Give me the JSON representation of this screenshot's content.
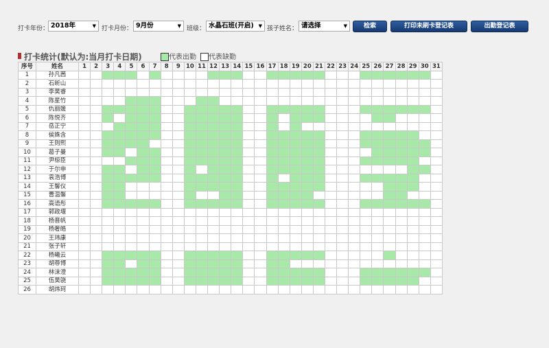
{
  "filters": {
    "year_label": "打卡年份：",
    "year_value": "2018年",
    "month_label": "打卡月份：",
    "month_value": "9月份",
    "class_label": "班级：",
    "class_value": "水晶石班(开启)",
    "child_label": "孩子姓名：",
    "child_value": "请选择",
    "search_button": "检索",
    "print_unswiped_button": "打印未刷卡登记表",
    "attendance_register_button": "出勤登记表"
  },
  "section_title": "打卡统计(默认为:当月打卡日期)",
  "legend": {
    "present_label": "代表出勤",
    "absent_label": "代表缺勤",
    "present_color": "#a8e8a8",
    "absent_color": "#ffffff"
  },
  "table": {
    "col_index": "序号",
    "col_name": "姓名",
    "days": [
      "1",
      "2",
      "3",
      "4",
      "5",
      "6",
      "7",
      "8",
      "9",
      "10",
      "11",
      "12",
      "13",
      "14",
      "15",
      "16",
      "17",
      "18",
      "19",
      "20",
      "21",
      "22",
      "23",
      "24",
      "25",
      "26",
      "27",
      "28",
      "29",
      "30",
      "31"
    ],
    "rows": [
      {
        "no": "1",
        "name": "孙凡茜",
        "present": [
          3,
          4,
          5,
          7,
          12,
          13,
          14,
          17,
          18,
          19,
          20,
          21,
          25,
          26,
          27,
          28,
          29,
          30
        ]
      },
      {
        "no": "2",
        "name": "石昕山",
        "present": []
      },
      {
        "no": "3",
        "name": "李昊睿",
        "present": []
      },
      {
        "no": "4",
        "name": "陈星竹",
        "present": [
          5,
          6,
          7,
          11,
          12
        ]
      },
      {
        "no": "5",
        "name": "仇丽媛",
        "present": [
          3,
          4,
          5,
          6,
          7,
          10,
          11,
          12,
          13,
          14,
          17,
          18,
          19,
          20,
          21,
          25,
          26,
          27,
          28,
          29,
          30
        ]
      },
      {
        "no": "6",
        "name": "陈悦齐",
        "present": [
          3,
          5,
          6,
          7,
          10,
          11,
          12,
          13,
          14,
          17,
          19,
          20,
          21,
          26,
          27
        ]
      },
      {
        "no": "7",
        "name": "岳正宁",
        "present": [
          4,
          5,
          6,
          7,
          10,
          11,
          12,
          13,
          14,
          17,
          19
        ]
      },
      {
        "no": "8",
        "name": "侯姝含",
        "present": [
          3,
          4,
          5,
          6,
          7,
          10,
          11,
          12,
          13,
          14,
          17,
          18,
          19,
          20,
          21,
          25,
          26,
          27,
          28,
          29
        ]
      },
      {
        "no": "9",
        "name": "王则熙",
        "present": [
          3,
          4,
          5,
          6,
          10,
          11,
          12,
          13,
          14,
          17,
          18,
          19,
          20,
          21,
          25,
          26,
          27,
          28,
          29,
          30
        ]
      },
      {
        "no": "10",
        "name": "葛子曼",
        "present": [
          3,
          4,
          6,
          7,
          10,
          11,
          12,
          13,
          14,
          17,
          18,
          19,
          20,
          21,
          26,
          27,
          28,
          29,
          30
        ]
      },
      {
        "no": "11",
        "name": "尹椋臣",
        "present": [
          5,
          6,
          7,
          10,
          11,
          12,
          13,
          14,
          17,
          18,
          19,
          20,
          21,
          25,
          26,
          27,
          28,
          29
        ]
      },
      {
        "no": "12",
        "name": "于尔申",
        "present": [
          3,
          4,
          6,
          7,
          10,
          12,
          13,
          14,
          17,
          18,
          19,
          20,
          21,
          29,
          30
        ]
      },
      {
        "no": "13",
        "name": "袁浩博",
        "present": [
          3,
          4,
          5,
          6,
          7,
          10,
          11,
          12,
          13,
          14,
          17,
          19,
          20,
          21,
          25,
          26,
          27,
          28,
          29
        ]
      },
      {
        "no": "14",
        "name": "王馨仪",
        "present": [
          3,
          4,
          10,
          11,
          12,
          13,
          14,
          17,
          18,
          19,
          20,
          21,
          27,
          28,
          29
        ]
      },
      {
        "no": "15",
        "name": "曹温馨",
        "present": [
          3,
          4,
          10,
          13,
          14,
          17,
          18,
          19,
          20,
          27,
          28
        ]
      },
      {
        "no": "16",
        "name": "高语彤",
        "present": [
          3,
          4,
          5,
          6,
          7,
          10,
          11,
          12,
          13,
          14,
          17,
          18,
          19,
          20,
          21,
          25,
          26,
          27,
          28,
          29,
          30
        ]
      },
      {
        "no": "17",
        "name": "郭政堰",
        "present": []
      },
      {
        "no": "18",
        "name": "杨晋帆",
        "present": []
      },
      {
        "no": "19",
        "name": "杨奢皓",
        "present": []
      },
      {
        "no": "20",
        "name": "王玮康",
        "present": []
      },
      {
        "no": "21",
        "name": "张子轩",
        "present": []
      },
      {
        "no": "22",
        "name": "杨曦云",
        "present": [
          3,
          4,
          5,
          6,
          7,
          10,
          11,
          12,
          13,
          14,
          17,
          18,
          19,
          20,
          21,
          27
        ]
      },
      {
        "no": "23",
        "name": "胡尊博",
        "present": [
          3,
          4,
          6,
          7,
          10,
          11,
          12,
          13,
          14,
          17,
          18
        ]
      },
      {
        "no": "24",
        "name": "林沫澄",
        "present": [
          3,
          4,
          5,
          6,
          7,
          10,
          11,
          12,
          13,
          14,
          17,
          18,
          19,
          20,
          21,
          25,
          26,
          27,
          28,
          29,
          30
        ]
      },
      {
        "no": "25",
        "name": "伍昊骁",
        "present": [
          3,
          4,
          5,
          6,
          7,
          10,
          11,
          12,
          13,
          14,
          17,
          18,
          19,
          20,
          21,
          25,
          26,
          27,
          28,
          29
        ]
      },
      {
        "no": "26",
        "name": "胡炜珂",
        "present": []
      }
    ]
  }
}
